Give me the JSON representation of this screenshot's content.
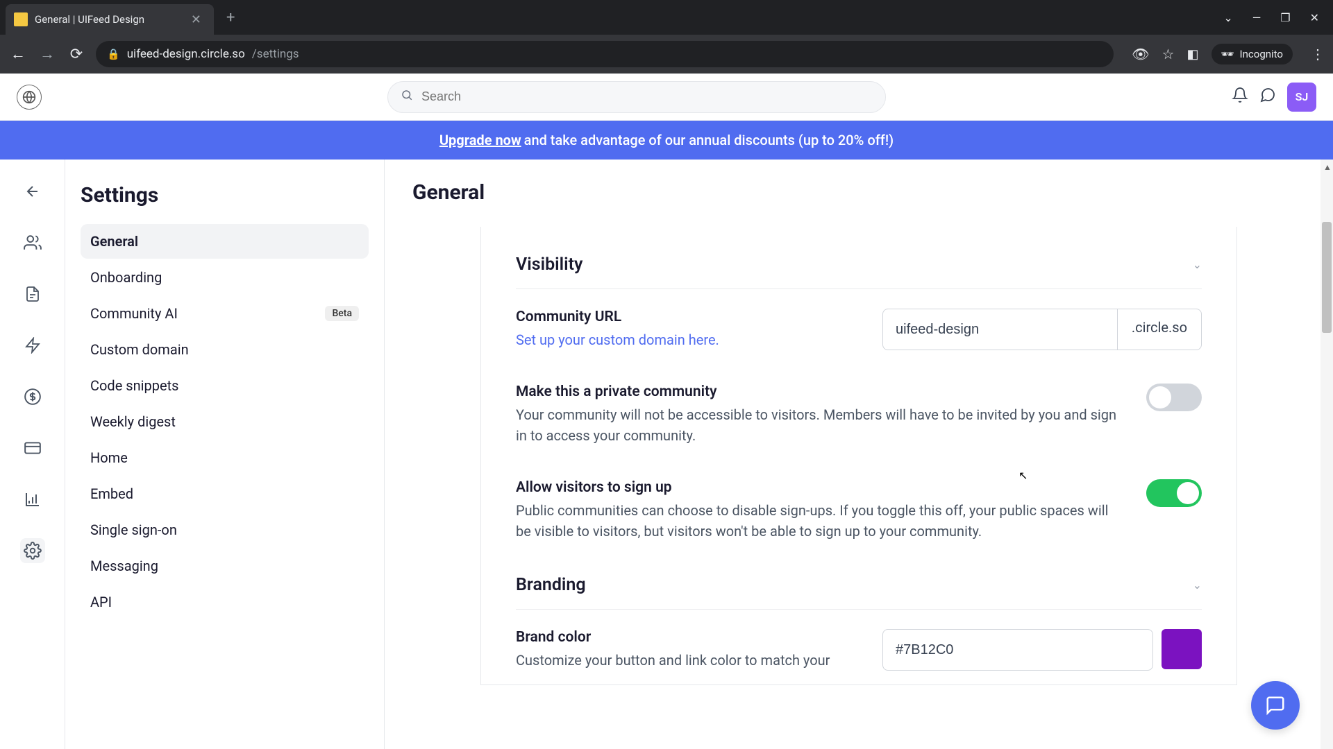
{
  "browser": {
    "tab_title": "General | UIFeed Design",
    "url_host": "uifeed-design.circle.so",
    "url_path": "/settings",
    "incognito_label": "Incognito"
  },
  "header": {
    "search_placeholder": "Search",
    "avatar_initials": "SJ"
  },
  "banner": {
    "link": "Upgrade now",
    "text": " and take advantage of our annual discounts (up to 20% off!)"
  },
  "sidebar": {
    "title": "Settings",
    "items": [
      {
        "label": "General",
        "active": true
      },
      {
        "label": "Onboarding"
      },
      {
        "label": "Community AI",
        "badge": "Beta"
      },
      {
        "label": "Custom domain"
      },
      {
        "label": "Code snippets"
      },
      {
        "label": "Weekly digest"
      },
      {
        "label": "Home"
      },
      {
        "label": "Embed"
      },
      {
        "label": "Single sign-on"
      },
      {
        "label": "Messaging"
      },
      {
        "label": "API"
      }
    ]
  },
  "page": {
    "title": "General",
    "visibility": {
      "heading": "Visibility",
      "url_label": "Community URL",
      "url_hint": "Set up your custom domain here.",
      "url_value": "uifeed-design",
      "url_suffix": ".circle.so",
      "private_label": "Make this a private community",
      "private_desc": "Your community will not be accessible to visitors. Members will have to be invited by you and sign in to access your community.",
      "private_on": false,
      "signup_label": "Allow visitors to sign up",
      "signup_desc": "Public communities can choose to disable sign-ups. If you toggle this off, your public spaces will be visible to visitors, but visitors won't be able to sign up to your community.",
      "signup_on": true
    },
    "branding": {
      "heading": "Branding",
      "color_label": "Brand color",
      "color_desc": "Customize your button and link color to match your",
      "color_value": "#7B12C0"
    }
  }
}
